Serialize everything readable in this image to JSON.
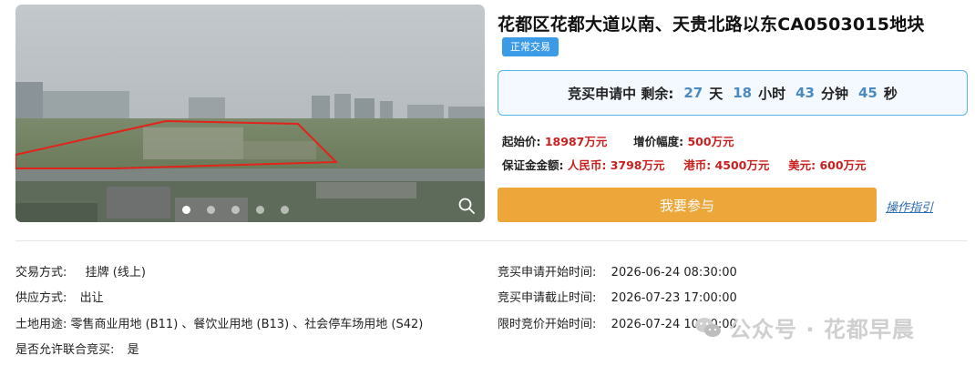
{
  "listing": {
    "title": "花都区花都大道以南、天贵北路以东CA0503015地块",
    "status_badge": "正常交易"
  },
  "gallery": {
    "slide_count": 5,
    "active_slide": 1,
    "zoom_icon": "magnifier-icon"
  },
  "countdown": {
    "label": "竞买申请中  剩余:",
    "days": "27",
    "days_unit": "天",
    "hours": "18",
    "hours_unit": "小时",
    "minutes": "43",
    "minutes_unit": "分钟",
    "seconds": "45",
    "seconds_unit": "秒"
  },
  "pricing": {
    "start_price_label": "起始价:",
    "start_price": "18987万元",
    "increment_label": "增价幅度:",
    "increment": "500万元",
    "deposit_label": "保证金金额:",
    "rmb_label": "人民币:",
    "rmb": "3798万元",
    "hkd_label": "港币:",
    "hkd": "4500万元",
    "usd_label": "美元:",
    "usd": "600万元"
  },
  "actions": {
    "join_label": "我要参与",
    "guide_label": "操作指引"
  },
  "details_left": {
    "trade_mode_label": "交易方式:",
    "trade_mode": "挂牌 (线上)",
    "supply_mode_label": "供应方式:",
    "supply_mode": "出让",
    "land_use_label": "土地用途:",
    "land_use": "零售商业用地 (B11) 、餐饮业用地 (B13) 、社会停车场用地 (S42)",
    "joint_bid_label": "是否允许联合竞买:",
    "joint_bid": "是"
  },
  "details_right": {
    "apply_start_label": "竞买申请开始时间:",
    "apply_start": "2026-06-24 08:30:00",
    "apply_end_label": "竞买申请截止时间:",
    "apply_end": "2026-07-23 17:00:00",
    "timed_bid_start_label": "限时竞价开始时间:",
    "timed_bid_start": "2026-07-24 10:00:00"
  },
  "watermark": {
    "text": "公众号 · 花都早晨",
    "icon": "wechat-icon"
  },
  "colors": {
    "accent_blue": "#3b9be6",
    "countdown_number": "#4a8ac0",
    "price_red": "#c9201e",
    "button_orange": "#eca63a",
    "link_blue": "#2f6db5"
  }
}
